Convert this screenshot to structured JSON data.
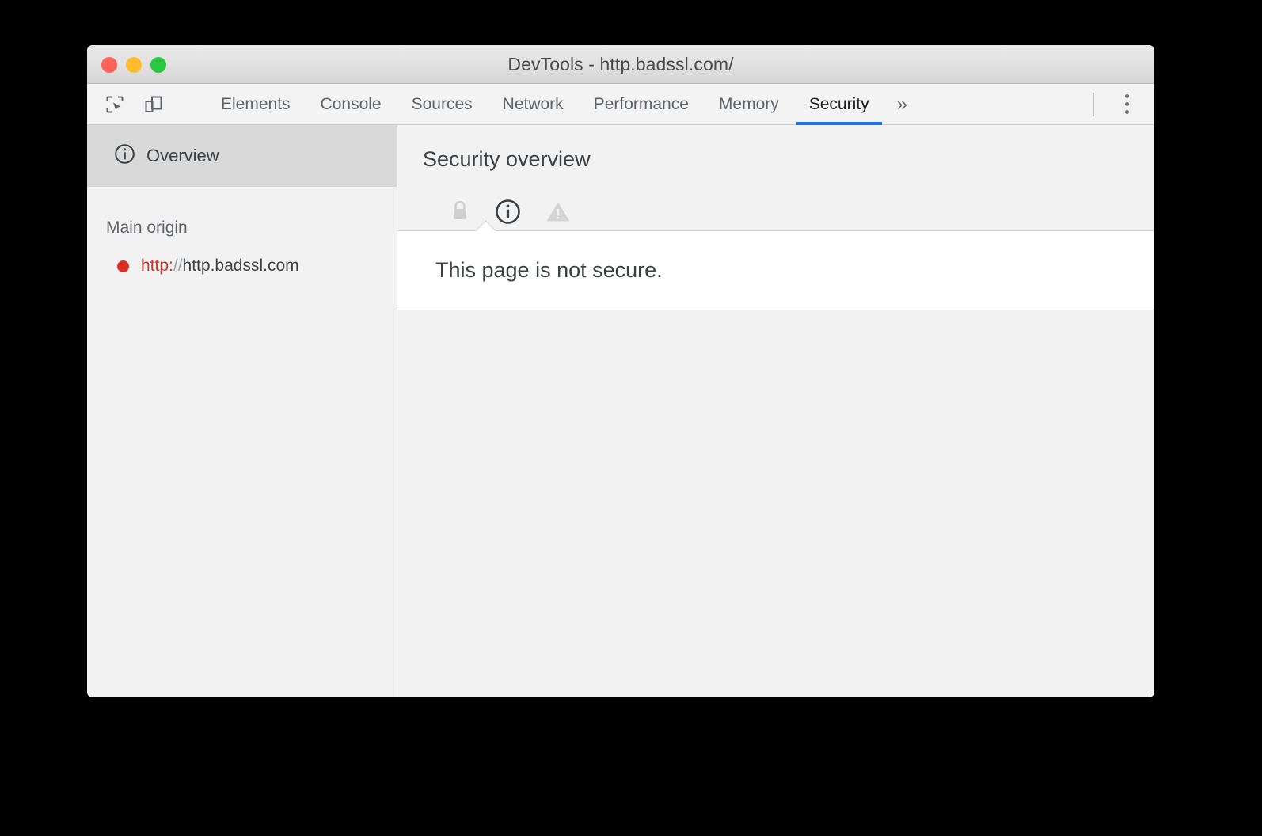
{
  "window": {
    "title": "DevTools - http.badssl.com/",
    "traffic_lights": [
      {
        "name": "close",
        "color": "#ff6259"
      },
      {
        "name": "minimize",
        "color": "#ffbd2d"
      },
      {
        "name": "maximize",
        "color": "#2ac840"
      }
    ]
  },
  "toolbar": {
    "inspect_icon": "inspect-element-icon",
    "device_icon": "device-toolbar-icon",
    "more_tabs_label": "»",
    "kebab_icon": "more-options-icon"
  },
  "tabs": [
    {
      "label": "Elements",
      "active": false
    },
    {
      "label": "Console",
      "active": false
    },
    {
      "label": "Sources",
      "active": false
    },
    {
      "label": "Network",
      "active": false
    },
    {
      "label": "Performance",
      "active": false
    },
    {
      "label": "Memory",
      "active": false
    },
    {
      "label": "Security",
      "active": true
    }
  ],
  "sidebar": {
    "overview": {
      "label": "Overview",
      "icon": "info-circle-icon",
      "selected": true
    },
    "group_title": "Main origin",
    "origins": [
      {
        "status_color": "#d93025",
        "scheme": "http:",
        "slashes": "//",
        "host": "http.badssl.com"
      }
    ]
  },
  "main": {
    "title": "Security overview",
    "state_icons": [
      {
        "name": "lock-icon",
        "state": "disabled"
      },
      {
        "name": "info-circle-icon",
        "state": "active"
      },
      {
        "name": "warning-triangle-icon",
        "state": "disabled"
      }
    ],
    "summary_text": "This page is not secure."
  },
  "colors": {
    "accent": "#1a73e8",
    "insecure": "#d93025",
    "text_primary": "#3c4043",
    "text_secondary": "#5f6368"
  }
}
